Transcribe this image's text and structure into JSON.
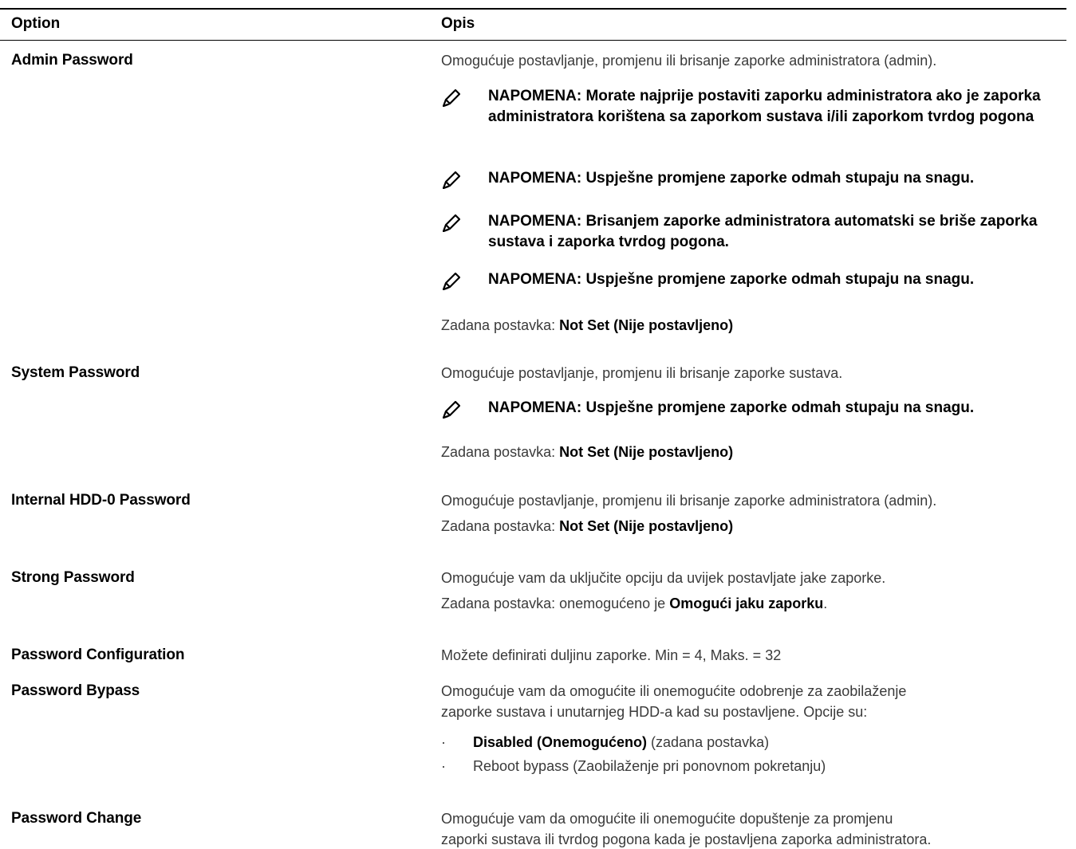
{
  "header": {
    "col_option": "Option",
    "col_desc": "Opis"
  },
  "note_label": "NAPOMENA:",
  "default_prefix": "Zadana postavka: ",
  "default_not_set": "Not Set (Nije postavljeno)",
  "rows": {
    "admin": {
      "name": "Admin Password",
      "desc": "Omogućuje postavljanje, promjenu ili brisanje zaporke administratora (admin).",
      "notes": [
        "NAPOMENA: Morate najprije postaviti zaporku administratora ako je zaporka administratora korištena sa zaporkom sustava i/ili zaporkom tvrdog pogona",
        "NAPOMENA: Uspješne promjene zaporke odmah stupaju na snagu.",
        "NAPOMENA: Brisanjem zaporke administratora automatski se briše zaporka sustava i zaporka tvrdog pogona.",
        "NAPOMENA: Uspješne promjene zaporke odmah stupaju na snagu."
      ]
    },
    "system": {
      "name": "System Password",
      "desc": "Omogućuje postavljanje, promjenu ili brisanje zaporke sustava.",
      "notes": [
        "NAPOMENA: Uspješne promjene zaporke odmah stupaju na snagu."
      ]
    },
    "hdd": {
      "name": "Internal HDD-0 Password",
      "desc": "Omogućuje postavljanje, promjenu ili brisanje zaporke administratora (admin)."
    },
    "strong": {
      "name": "Strong Password",
      "desc": "Omogućuje vam da uključite opciju da uvijek postavljate jake zaporke.",
      "default_text": "Zadana postavka: onemogućeno je ",
      "default_bold": "Omogući jaku zaporku",
      "default_end": "."
    },
    "config": {
      "name": "Password Configuration",
      "desc": "Možete definirati duljinu zaporke. Min = 4, Maks. = 32"
    },
    "bypass": {
      "name": "Password Bypass",
      "desc_line1": "Omogućuje vam da omogućite ili onemogućite odobrenje za zaobilaženje",
      "desc_line2": "zaporke sustava i unutarnjeg HDD-a kad su postavljene. Opcije su:",
      "options": [
        {
          "bold": "Disabled (Onemogućeno)",
          "rest": " (zadana postavka)"
        },
        {
          "bold": "",
          "rest": "Reboot bypass (Zaobilaženje pri ponovnom pokretanju)"
        }
      ]
    },
    "change": {
      "name": "Password Change",
      "desc_line1": "Omogućuje vam da omogućite ili onemogućite dopuštenje za promjenu",
      "desc_line2": "zaporki sustava ili tvrdog pogona kada je postavljena zaporka administratora."
    }
  }
}
